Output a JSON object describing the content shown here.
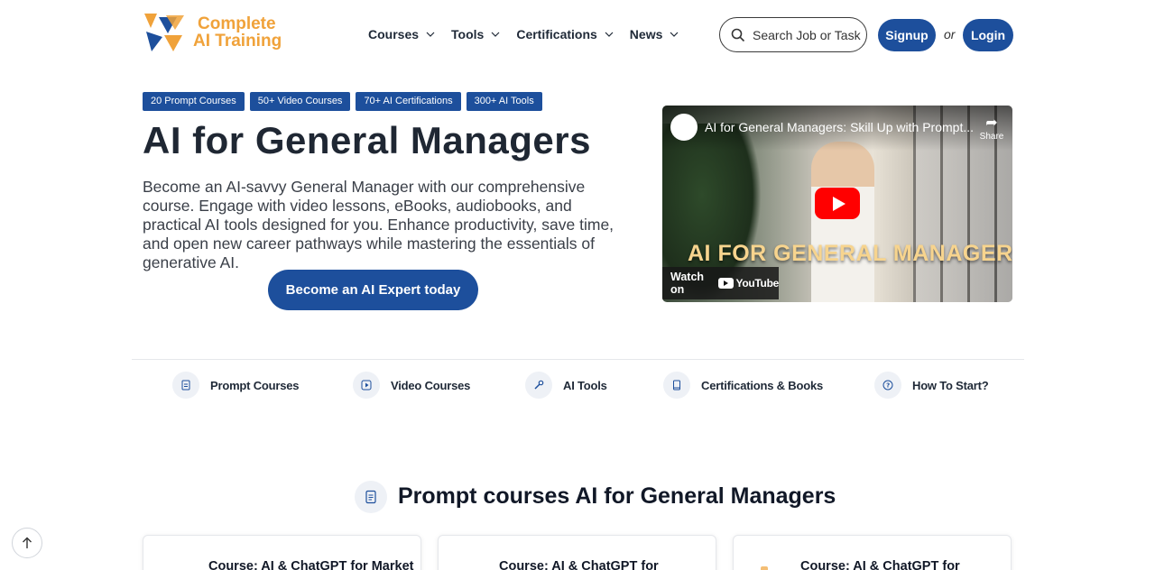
{
  "brand": {
    "line1": "Complete",
    "line2": "AI Training",
    "colors": {
      "orange": "#f0a23a",
      "blue": "#1d4f9c"
    }
  },
  "nav": {
    "items": [
      {
        "label": "Courses",
        "icon": "chevron-down-icon"
      },
      {
        "label": "Tools",
        "icon": "chevron-down-icon"
      },
      {
        "label": "Certifications",
        "icon": "chevron-down-icon"
      },
      {
        "label": "News",
        "icon": "chevron-down-icon"
      }
    ],
    "search_placeholder": "Search Job or Tasks",
    "signup_label": "Signup",
    "or_text": "or",
    "login_label": "Login"
  },
  "hero": {
    "badges": [
      "20 Prompt Courses",
      "50+ Video Courses",
      "70+ AI Certifications",
      "300+ AI Tools"
    ],
    "title": "AI for General Managers",
    "description": "Become an AI-savvy General Manager with our comprehensive course. Engage with video lessons, eBooks, audiobooks, and practical AI tools designed for you. Enhance productivity, save time, and open new career pathways while mastering the essentials of generative AI.",
    "cta_label": "Become an AI Expert today"
  },
  "video": {
    "title": "AI for General Managers: Skill Up with Prompt...",
    "share_label": "Share",
    "overlay_text": "AI FOR GENERAL MANAGERS",
    "watch_on": "Watch on",
    "youtube_label": "YouTube"
  },
  "categories": [
    {
      "label": "Prompt Courses",
      "icon": "document-icon"
    },
    {
      "label": "Video Courses",
      "icon": "play-icon"
    },
    {
      "label": "AI Tools",
      "icon": "wrench-icon"
    },
    {
      "label": "Certifications & Books",
      "icon": "book-icon"
    },
    {
      "label": "How To Start?",
      "icon": "question-icon"
    }
  ],
  "section": {
    "title": "Prompt courses AI for General Managers",
    "icon": "document-icon"
  },
  "cards": [
    {
      "title": "Course: AI & ChatGPT for Market"
    },
    {
      "title": "Course: AI & ChatGPT for"
    },
    {
      "title": "Course: AI & ChatGPT for"
    }
  ]
}
